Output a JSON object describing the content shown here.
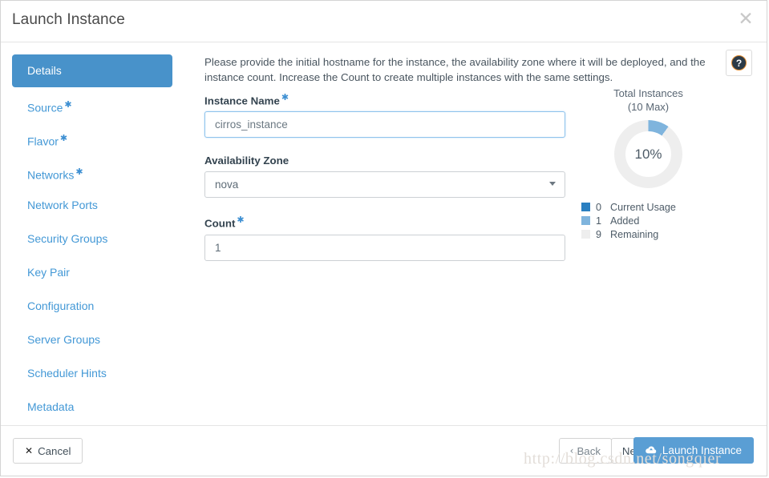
{
  "dialog": {
    "title": "Launch Instance",
    "close_icon": "close-icon"
  },
  "sidebar": {
    "items": [
      {
        "label": "Details",
        "required": false,
        "active": true
      },
      {
        "label": "Source",
        "required": true,
        "active": false
      },
      {
        "label": "Flavor",
        "required": true,
        "active": false
      },
      {
        "label": "Networks",
        "required": true,
        "active": false
      },
      {
        "label": "Network Ports",
        "required": false,
        "active": false
      },
      {
        "label": "Security Groups",
        "required": false,
        "active": false
      },
      {
        "label": "Key Pair",
        "required": false,
        "active": false
      },
      {
        "label": "Configuration",
        "required": false,
        "active": false
      },
      {
        "label": "Server Groups",
        "required": false,
        "active": false
      },
      {
        "label": "Scheduler Hints",
        "required": false,
        "active": false
      },
      {
        "label": "Metadata",
        "required": false,
        "active": false
      }
    ]
  },
  "main": {
    "description": "Please provide the initial hostname for the instance, the availability zone where it will be deployed, and the instance count. Increase the Count to create multiple instances with the same settings.",
    "help_label": "?",
    "fields": {
      "instance_name": {
        "label": "Instance Name",
        "required": true,
        "value": "cirros_instance",
        "placeholder": ""
      },
      "availability_zone": {
        "label": "Availability Zone",
        "required": false,
        "value": "nova",
        "options": [
          "nova"
        ]
      },
      "count": {
        "label": "Count",
        "required": true,
        "value": "1",
        "placeholder": ""
      }
    }
  },
  "quota": {
    "title_line1": "Total Instances",
    "title_line2": "(10 Max)",
    "percent_label": "10%"
  },
  "chart_data": {
    "type": "pie",
    "title": "Total Instances (10 Max)",
    "center_label": "10%",
    "max": 10,
    "categories": [
      "Current Usage",
      "Added",
      "Remaining"
    ],
    "values": [
      0,
      1,
      9
    ],
    "colors": [
      "#2a7fc1",
      "#7fb4dd",
      "#eeeeee"
    ],
    "legend": [
      {
        "count": "0",
        "label": "Current Usage",
        "color": "#2a7fc1"
      },
      {
        "count": "1",
        "label": "Added",
        "color": "#7fb4dd"
      },
      {
        "count": "9",
        "label": "Remaining",
        "color": "#eeeeee"
      }
    ],
    "legend_position": "below"
  },
  "footer": {
    "cancel": "Cancel",
    "back": "Back",
    "next": "Next",
    "launch": "Launch Instance"
  },
  "watermark": {
    "text": "http://blog.csdn.net/songqier"
  }
}
